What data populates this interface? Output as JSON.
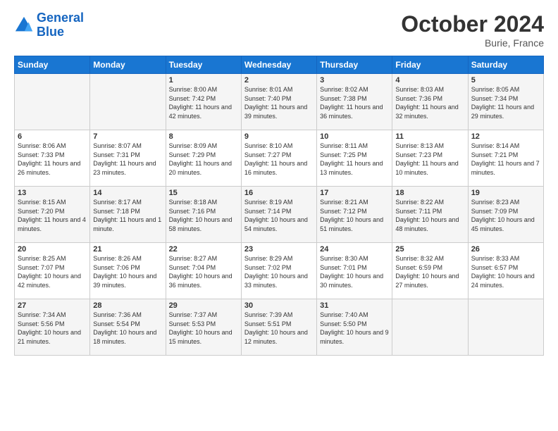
{
  "header": {
    "logo_line1": "General",
    "logo_line2": "Blue",
    "month_title": "October 2024",
    "location": "Burie, France"
  },
  "weekdays": [
    "Sunday",
    "Monday",
    "Tuesday",
    "Wednesday",
    "Thursday",
    "Friday",
    "Saturday"
  ],
  "rows": [
    [
      {
        "day": "",
        "info": ""
      },
      {
        "day": "",
        "info": ""
      },
      {
        "day": "1",
        "info": "Sunrise: 8:00 AM\nSunset: 7:42 PM\nDaylight: 11 hours and 42 minutes."
      },
      {
        "day": "2",
        "info": "Sunrise: 8:01 AM\nSunset: 7:40 PM\nDaylight: 11 hours and 39 minutes."
      },
      {
        "day": "3",
        "info": "Sunrise: 8:02 AM\nSunset: 7:38 PM\nDaylight: 11 hours and 36 minutes."
      },
      {
        "day": "4",
        "info": "Sunrise: 8:03 AM\nSunset: 7:36 PM\nDaylight: 11 hours and 32 minutes."
      },
      {
        "day": "5",
        "info": "Sunrise: 8:05 AM\nSunset: 7:34 PM\nDaylight: 11 hours and 29 minutes."
      }
    ],
    [
      {
        "day": "6",
        "info": "Sunrise: 8:06 AM\nSunset: 7:33 PM\nDaylight: 11 hours and 26 minutes."
      },
      {
        "day": "7",
        "info": "Sunrise: 8:07 AM\nSunset: 7:31 PM\nDaylight: 11 hours and 23 minutes."
      },
      {
        "day": "8",
        "info": "Sunrise: 8:09 AM\nSunset: 7:29 PM\nDaylight: 11 hours and 20 minutes."
      },
      {
        "day": "9",
        "info": "Sunrise: 8:10 AM\nSunset: 7:27 PM\nDaylight: 11 hours and 16 minutes."
      },
      {
        "day": "10",
        "info": "Sunrise: 8:11 AM\nSunset: 7:25 PM\nDaylight: 11 hours and 13 minutes."
      },
      {
        "day": "11",
        "info": "Sunrise: 8:13 AM\nSunset: 7:23 PM\nDaylight: 11 hours and 10 minutes."
      },
      {
        "day": "12",
        "info": "Sunrise: 8:14 AM\nSunset: 7:21 PM\nDaylight: 11 hours and 7 minutes."
      }
    ],
    [
      {
        "day": "13",
        "info": "Sunrise: 8:15 AM\nSunset: 7:20 PM\nDaylight: 11 hours and 4 minutes."
      },
      {
        "day": "14",
        "info": "Sunrise: 8:17 AM\nSunset: 7:18 PM\nDaylight: 11 hours and 1 minute."
      },
      {
        "day": "15",
        "info": "Sunrise: 8:18 AM\nSunset: 7:16 PM\nDaylight: 10 hours and 58 minutes."
      },
      {
        "day": "16",
        "info": "Sunrise: 8:19 AM\nSunset: 7:14 PM\nDaylight: 10 hours and 54 minutes."
      },
      {
        "day": "17",
        "info": "Sunrise: 8:21 AM\nSunset: 7:12 PM\nDaylight: 10 hours and 51 minutes."
      },
      {
        "day": "18",
        "info": "Sunrise: 8:22 AM\nSunset: 7:11 PM\nDaylight: 10 hours and 48 minutes."
      },
      {
        "day": "19",
        "info": "Sunrise: 8:23 AM\nSunset: 7:09 PM\nDaylight: 10 hours and 45 minutes."
      }
    ],
    [
      {
        "day": "20",
        "info": "Sunrise: 8:25 AM\nSunset: 7:07 PM\nDaylight: 10 hours and 42 minutes."
      },
      {
        "day": "21",
        "info": "Sunrise: 8:26 AM\nSunset: 7:06 PM\nDaylight: 10 hours and 39 minutes."
      },
      {
        "day": "22",
        "info": "Sunrise: 8:27 AM\nSunset: 7:04 PM\nDaylight: 10 hours and 36 minutes."
      },
      {
        "day": "23",
        "info": "Sunrise: 8:29 AM\nSunset: 7:02 PM\nDaylight: 10 hours and 33 minutes."
      },
      {
        "day": "24",
        "info": "Sunrise: 8:30 AM\nSunset: 7:01 PM\nDaylight: 10 hours and 30 minutes."
      },
      {
        "day": "25",
        "info": "Sunrise: 8:32 AM\nSunset: 6:59 PM\nDaylight: 10 hours and 27 minutes."
      },
      {
        "day": "26",
        "info": "Sunrise: 8:33 AM\nSunset: 6:57 PM\nDaylight: 10 hours and 24 minutes."
      }
    ],
    [
      {
        "day": "27",
        "info": "Sunrise: 7:34 AM\nSunset: 5:56 PM\nDaylight: 10 hours and 21 minutes."
      },
      {
        "day": "28",
        "info": "Sunrise: 7:36 AM\nSunset: 5:54 PM\nDaylight: 10 hours and 18 minutes."
      },
      {
        "day": "29",
        "info": "Sunrise: 7:37 AM\nSunset: 5:53 PM\nDaylight: 10 hours and 15 minutes."
      },
      {
        "day": "30",
        "info": "Sunrise: 7:39 AM\nSunset: 5:51 PM\nDaylight: 10 hours and 12 minutes."
      },
      {
        "day": "31",
        "info": "Sunrise: 7:40 AM\nSunset: 5:50 PM\nDaylight: 10 hours and 9 minutes."
      },
      {
        "day": "",
        "info": ""
      },
      {
        "day": "",
        "info": ""
      }
    ]
  ]
}
